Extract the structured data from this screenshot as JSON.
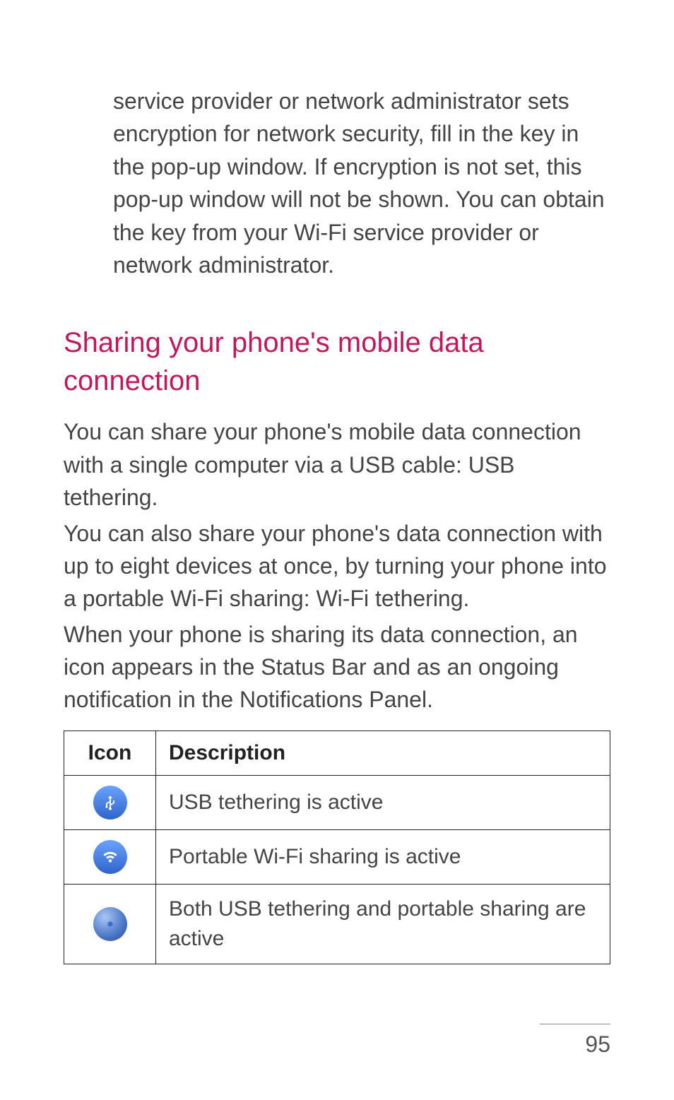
{
  "intro_paragraph": "service provider or network administrator sets encryption for network security, fill in the key in the pop-up window. If encryption is not set, this pop-up window will not be shown. You can obtain the key from your Wi-Fi service provider or network administrator.",
  "section_heading": "Sharing your phone's mobile data connection",
  "body_paragraphs": {
    "p1": "You can share your phone's mobile data connection with a single computer via a USB cable: USB tethering.",
    "p2": "You can also share your phone's data connection with up to eight devices at once, by turning your phone into a portable Wi-Fi sharing: Wi-Fi tethering.",
    "p3": "When your phone is sharing its data connection, an icon appears in the Status Bar and as an ongoing notification in the Notifications Panel."
  },
  "table": {
    "header_icon": "Icon",
    "header_desc": "Description",
    "rows": [
      {
        "icon_name": "usb-tether-icon",
        "icon_color": "#3b6fd6",
        "description": "USB tethering is active"
      },
      {
        "icon_name": "wifi-share-icon",
        "icon_color": "#2f64c9",
        "description": "Portable Wi-Fi sharing is active"
      },
      {
        "icon_name": "both-active-icon",
        "icon_color": "#2f64c9",
        "description": "Both USB tethering and portable sharing are active"
      }
    ]
  },
  "page_number": "95"
}
